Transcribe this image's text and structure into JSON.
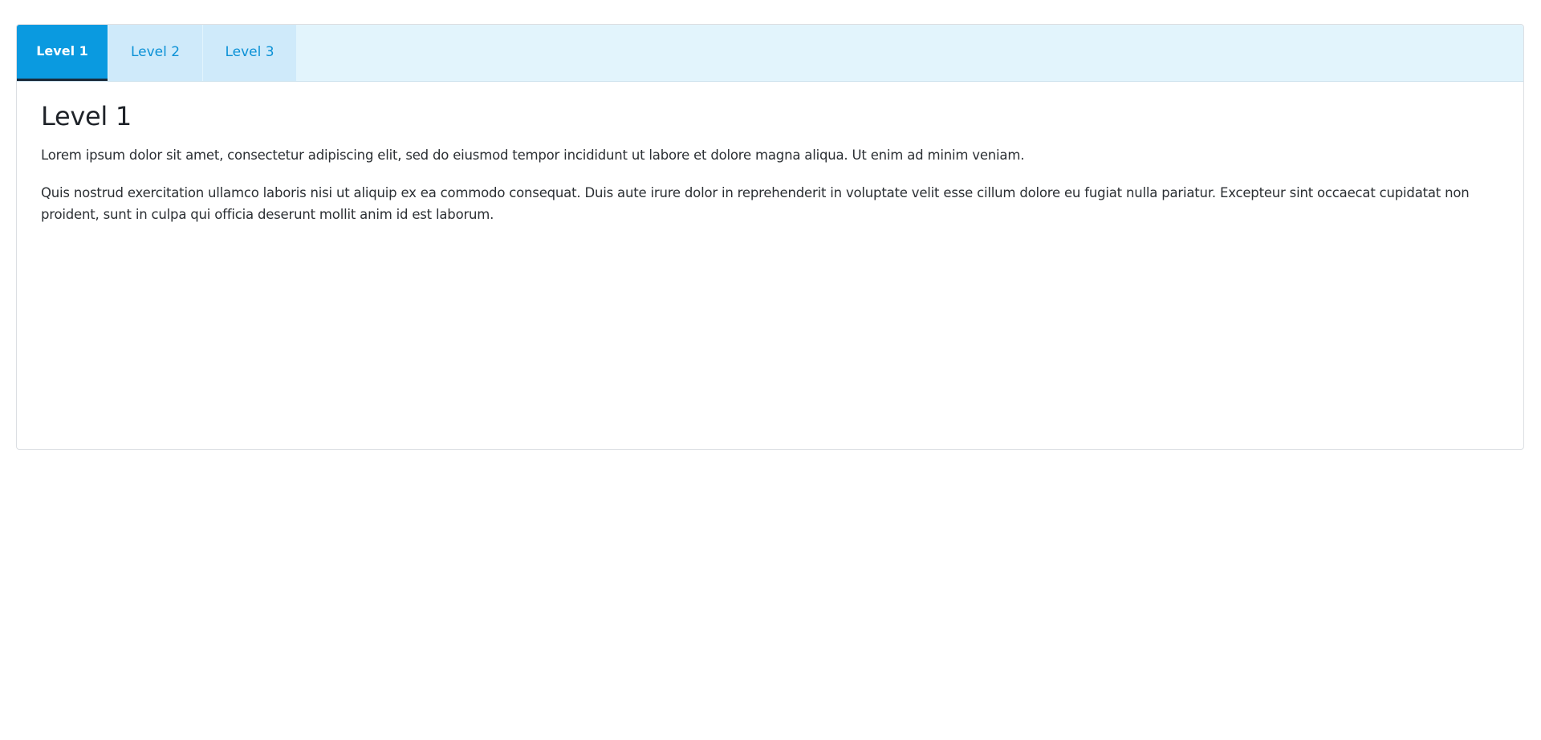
{
  "tabs": [
    {
      "label": "Level 1",
      "active": true
    },
    {
      "label": "Level 2",
      "active": false
    },
    {
      "label": "Level 3",
      "active": false
    }
  ],
  "content": {
    "title": "Level 1",
    "paragraphs": [
      "Lorem ipsum dolor sit amet, consectetur adipiscing elit, sed do eiusmod tempor incididunt ut labore et dolore magna aliqua. Ut enim ad minim veniam.",
      "Quis nostrud exercitation ullamco laboris nisi ut aliquip ex ea commodo consequat. Duis aute irure dolor in reprehenderit in voluptate velit esse cillum dolore eu fugiat nulla pariatur. Excepteur sint occaecat cupidatat non proident, sunt in culpa qui officia deserunt mollit anim id est laborum."
    ]
  },
  "colors": {
    "tab_active_bg": "#0a9ae0",
    "tab_inactive_bg": "#cfeafa",
    "tabbar_bg": "#e2f4fc",
    "tab_inactive_text": "#0b91d6"
  }
}
